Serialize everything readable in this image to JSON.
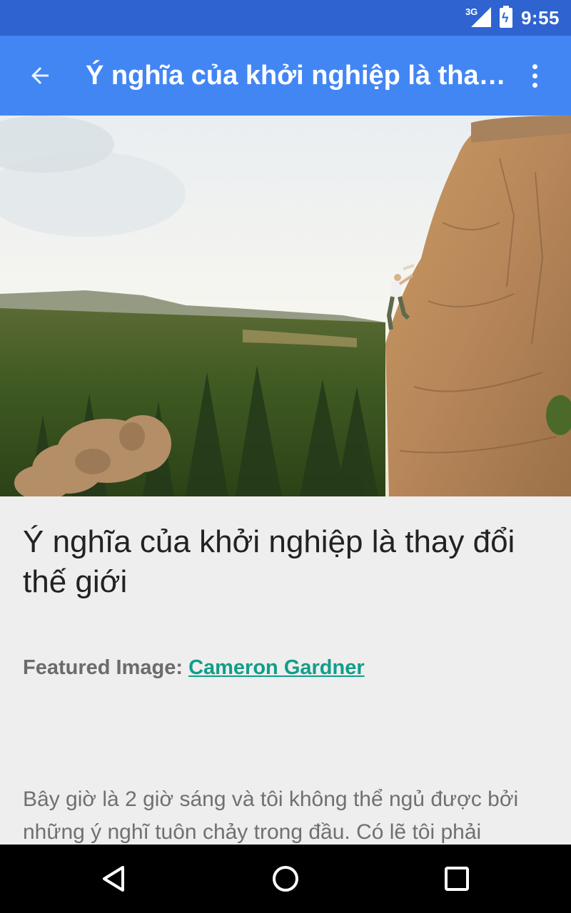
{
  "status_bar": {
    "network": "3G",
    "time": "9:55"
  },
  "app_bar": {
    "title": "Ý nghĩa của khởi nghiệp là thay đổi thế giới"
  },
  "hero_image": {
    "subject": "climber on sunlit granite cliff above pine forest"
  },
  "article": {
    "title": "Ý nghĩa của khởi nghiệp là thay đổi thế giới",
    "credit_label": "Featured Image:",
    "credit_name": "Cameron Gardner",
    "body": "Bây giờ là 2 giờ sáng và tôi không thể ngủ được bởi những ý nghĩ tuôn chảy trong đầu. Có lẽ tôi phải"
  },
  "colors": {
    "status_bar": "#2f63cf",
    "app_bar": "#4286f4",
    "link": "#109e8a",
    "background": "#eeeeee"
  },
  "icons": {
    "back": "arrow-back-icon",
    "overflow": "more-vert-icon",
    "nav_back": "triangle-back-icon",
    "nav_home": "circle-home-icon",
    "nav_recents": "square-recents-icon"
  }
}
